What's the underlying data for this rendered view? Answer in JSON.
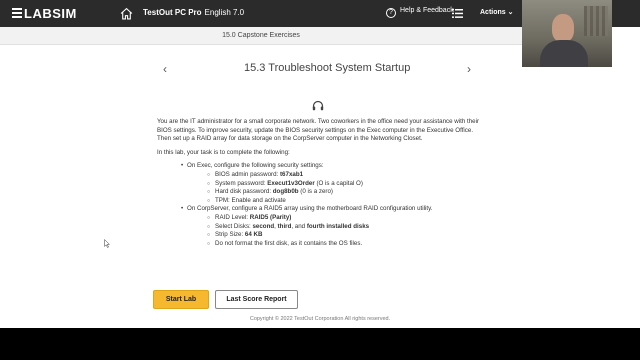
{
  "header": {
    "logo": "LABSIM",
    "product_title": "TestOut PC Pro",
    "language": "English 7.0",
    "help_label": "Help & Feedback",
    "actions_label": "Actions"
  },
  "breadcrumb": "15.0 Capstone Exercises",
  "lesson": {
    "title": "15.3 Troubleshoot System Startup"
  },
  "intro": "You are the IT administrator for a small corporate network. Two coworkers in the office need your assistance with their BIOS settings. To improve security, update the BIOS security settings on the Exec computer in the Executive Office. Then set up a RAID array for data storage on the CorpServer computer in the Networking Closet.",
  "task_lead": "In this lab, your task is to complete the following:",
  "tasks": {
    "exec": {
      "label": "On Exec, configure the following security settings:",
      "bios_pw_label": "BIOS admin password: ",
      "bios_pw": "t67xab1",
      "sys_pw_label": "System password: ",
      "sys_pw": "Execut1v3Order",
      "sys_pw_note": " (O is a capital O)",
      "hdd_pw_label": "Hard disk password: ",
      "hdd_pw": "dog8b0b",
      "hdd_pw_note": " (0 is a zero)",
      "tpm": "TPM: Enable and activate"
    },
    "corp": {
      "label": "On CorpServer, configure a RAID5 array using the motherboard RAID configuration utility.",
      "raid_label": "RAID Level: ",
      "raid_level": "RAID5 (Parity)",
      "disks_label": "Select Disks: ",
      "disk_second": "second",
      "disk_sep1": ", ",
      "disk_third": "third",
      "disk_sep2": ", and ",
      "disk_fourth": "fourth installed disks",
      "strip_label": "Strip Size: ",
      "strip_size": "64 KB",
      "no_format": "Do not format the first disk, as it contains the OS files."
    }
  },
  "buttons": {
    "start": "Start Lab",
    "report": "Last Score Report"
  },
  "footer": "Copyright © 2022 TestOut Corporation  All rights reserved.",
  "colors": {
    "topbar": "#2b2b2b",
    "start_button": "#f5b82e"
  }
}
